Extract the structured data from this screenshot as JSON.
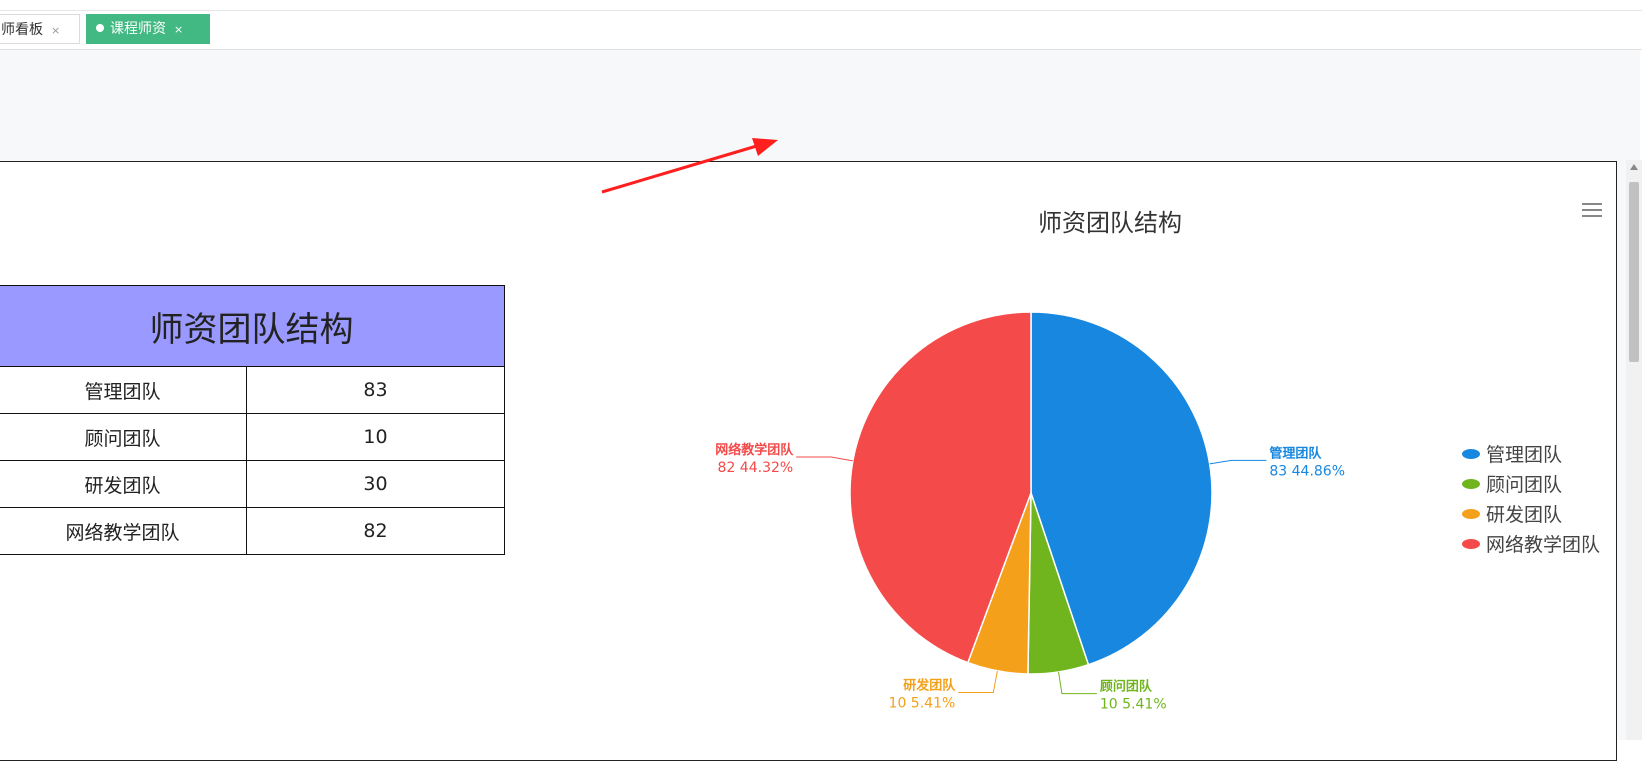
{
  "tabs": [
    {
      "label": "师看板",
      "close": "×",
      "active": false
    },
    {
      "label": "课程师资",
      "close": "×",
      "active": true
    }
  ],
  "table": {
    "title": "师资团队结构",
    "rows": [
      {
        "name": "管理团队",
        "value": "83"
      },
      {
        "name": "顾问团队",
        "value": "10"
      },
      {
        "name": "研发团队",
        "value": "30"
      },
      {
        "name": "网络教学团队",
        "value": "82"
      }
    ]
  },
  "chart_data": {
    "type": "pie",
    "title": "师资团队结构",
    "slices": [
      {
        "name": "管理团队",
        "value": 83,
        "percent": "44.86%",
        "color": "#1787e0"
      },
      {
        "name": "顾问团队",
        "value": 10,
        "percent": "5.41%",
        "color": "#70b51e"
      },
      {
        "name": "研发团队",
        "value": 10,
        "percent": "5.41%",
        "color": "#f4a01a"
      },
      {
        "name": "网络教学团队",
        "value": 82,
        "percent": "44.32%",
        "color": "#f44a4a"
      }
    ],
    "legend_position": "right"
  },
  "colors": {
    "tab_active": "#42b983",
    "table_header": "#9999ff",
    "annotation_arrow": "#ff1f1f"
  },
  "icons": {
    "chart_menu": "hamburger-menu-icon",
    "tab_status": "dot-icon"
  }
}
